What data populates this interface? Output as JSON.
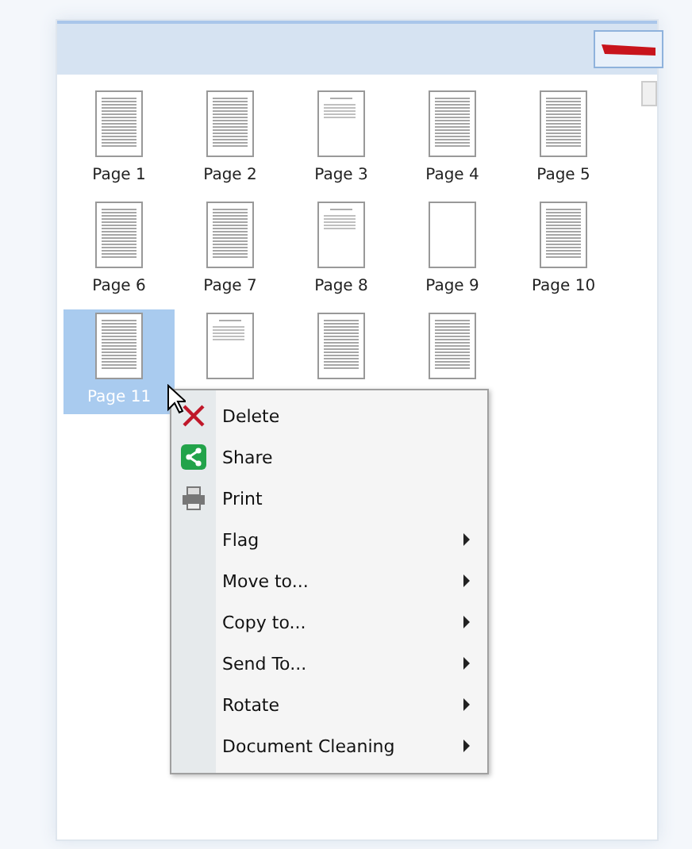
{
  "pages": [
    {
      "label": "Page 1",
      "kind": "dense",
      "selected": false
    },
    {
      "label": "Page 2",
      "kind": "dense",
      "selected": false
    },
    {
      "label": "Page 3",
      "kind": "sparse",
      "selected": false
    },
    {
      "label": "Page 4",
      "kind": "dense",
      "selected": false
    },
    {
      "label": "Page 5",
      "kind": "dense",
      "selected": false
    },
    {
      "label": "Page 6",
      "kind": "dense",
      "selected": false
    },
    {
      "label": "Page 7",
      "kind": "dense",
      "selected": false
    },
    {
      "label": "Page 8",
      "kind": "sparse",
      "selected": false
    },
    {
      "label": "Page 9",
      "kind": "blank",
      "selected": false
    },
    {
      "label": "Page 10",
      "kind": "dense",
      "selected": false
    },
    {
      "label": "Page 11",
      "kind": "dense",
      "selected": true
    },
    {
      "kind": "sparse",
      "selected": false
    },
    {
      "kind": "dense",
      "selected": false
    },
    {
      "kind": "dense",
      "selected": false
    }
  ],
  "context_menu": [
    {
      "label": "Delete",
      "kind": "delete",
      "submenu": false
    },
    {
      "label": "Share",
      "kind": "share",
      "submenu": false
    },
    {
      "label": "Print",
      "kind": "print",
      "submenu": false
    },
    {
      "label": "Flag",
      "submenu": true
    },
    {
      "label": "Move to...",
      "submenu": true
    },
    {
      "label": "Copy to...",
      "submenu": true
    },
    {
      "label": "Send To...",
      "submenu": true
    },
    {
      "label": "Rotate",
      "submenu": true
    },
    {
      "label": "Document Cleaning",
      "submenu": true
    }
  ]
}
